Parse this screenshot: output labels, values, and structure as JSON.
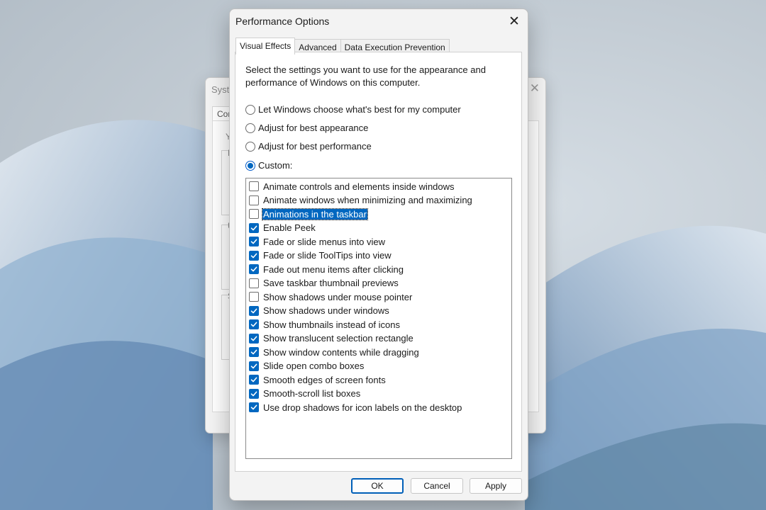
{
  "background_window": {
    "title": "Syst",
    "close_glyph": "✕",
    "tab_label": "Con",
    "fragments": [
      "Y",
      "P",
      "U",
      "S"
    ]
  },
  "dialog": {
    "title": "Performance Options",
    "close_glyph": "✕",
    "tabs": [
      {
        "label": "Visual Effects",
        "active": true
      },
      {
        "label": "Advanced",
        "active": false
      },
      {
        "label": "Data Execution Prevention",
        "active": false
      }
    ],
    "description": "Select the settings you want to use for the appearance and performance of Windows on this computer.",
    "radios": [
      {
        "label": "Let Windows choose what's best for my computer",
        "checked": false
      },
      {
        "label": "Adjust for best appearance",
        "checked": false
      },
      {
        "label": "Adjust for best performance",
        "checked": false
      },
      {
        "label": "Custom:",
        "checked": true
      }
    ],
    "effects": [
      {
        "label": "Animate controls and elements inside windows",
        "checked": false
      },
      {
        "label": "Animate windows when minimizing and maximizing",
        "checked": false
      },
      {
        "label": "Animations in the taskbar",
        "checked": false,
        "selected": true
      },
      {
        "label": "Enable Peek",
        "checked": true
      },
      {
        "label": "Fade or slide menus into view",
        "checked": true
      },
      {
        "label": "Fade or slide ToolTips into view",
        "checked": true
      },
      {
        "label": "Fade out menu items after clicking",
        "checked": true
      },
      {
        "label": "Save taskbar thumbnail previews",
        "checked": false
      },
      {
        "label": "Show shadows under mouse pointer",
        "checked": false
      },
      {
        "label": "Show shadows under windows",
        "checked": true
      },
      {
        "label": "Show thumbnails instead of icons",
        "checked": true
      },
      {
        "label": "Show translucent selection rectangle",
        "checked": true
      },
      {
        "label": "Show window contents while dragging",
        "checked": true
      },
      {
        "label": "Slide open combo boxes",
        "checked": true
      },
      {
        "label": "Smooth edges of screen fonts",
        "checked": true
      },
      {
        "label": "Smooth-scroll list boxes",
        "checked": true
      },
      {
        "label": "Use drop shadows for icon labels on the desktop",
        "checked": true
      }
    ],
    "buttons": {
      "ok": "OK",
      "cancel": "Cancel",
      "apply": "Apply"
    }
  },
  "colors": {
    "accent": "#0067c0",
    "wallpaper": "#c3ccd4",
    "bloom": "#7c9fc3"
  }
}
